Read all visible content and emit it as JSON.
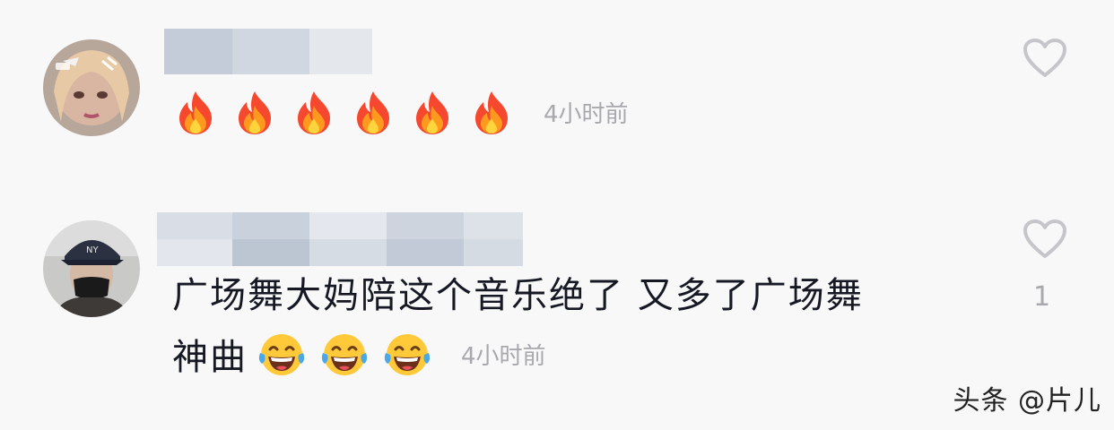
{
  "comments": [
    {
      "user": {
        "avatar": "avatar-girl"
      },
      "emojis": [
        "fire",
        "fire",
        "fire",
        "fire",
        "fire",
        "fire"
      ],
      "time": "4小时前",
      "likes": "",
      "liked": false
    },
    {
      "user": {
        "avatar": "avatar-man-cap-mask"
      },
      "text_line1": "广场舞大妈陪这个音乐绝了  又多了广场舞",
      "text_line2": "神曲",
      "emojis": [
        "tears-of-joy",
        "tears-of-joy",
        "tears-of-joy"
      ],
      "time": "4小时前",
      "likes": "1",
      "liked": false
    }
  ],
  "watermark": "头条 @片儿",
  "icons": {
    "like": "heart-outline-icon",
    "fire": "fire-emoji",
    "laugh": "tears-of-joy-emoji"
  },
  "colors": {
    "background": "#f8f8f8",
    "text": "#161823",
    "secondary": "#a8a8ad",
    "heart": "#c6c6ca"
  }
}
